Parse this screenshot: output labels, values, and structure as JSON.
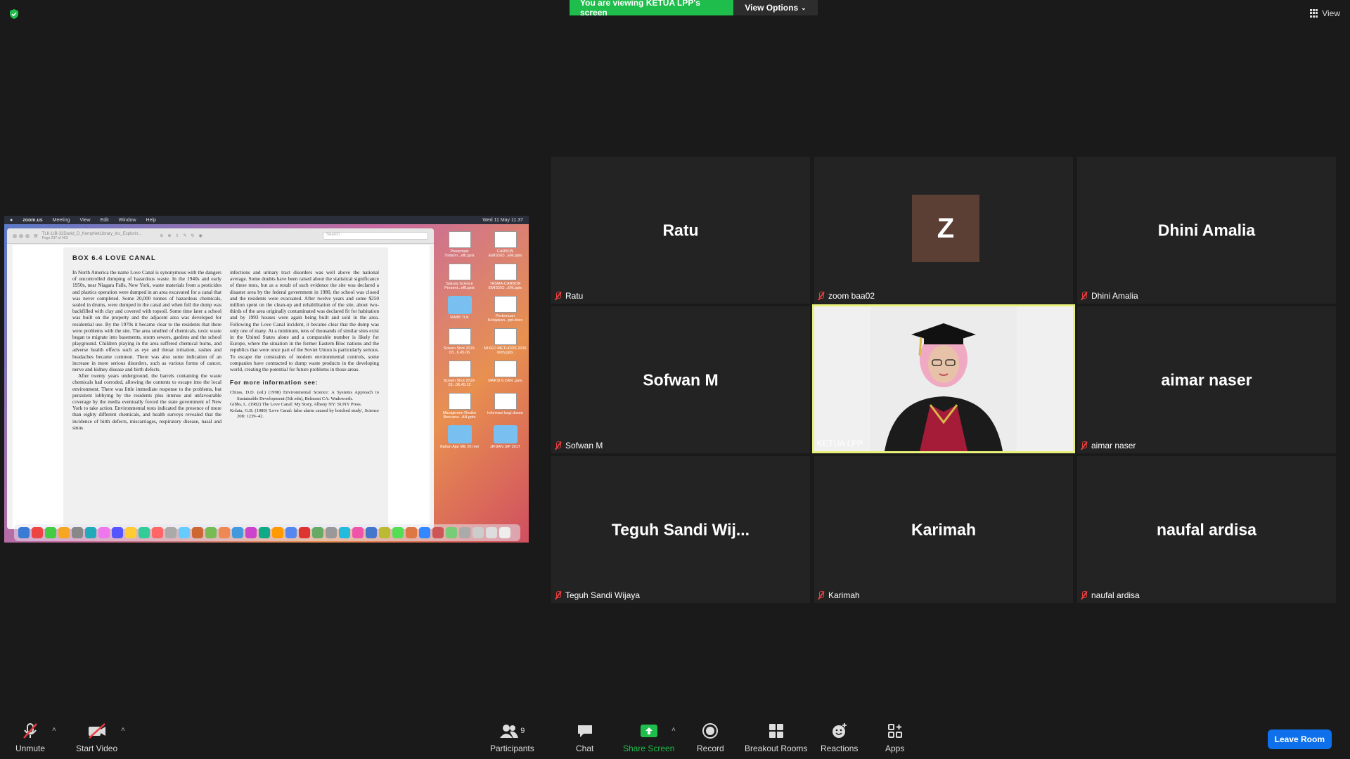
{
  "banner": {
    "viewing": "You are viewing KETUA LPP's screen",
    "view_options": "View Options"
  },
  "view_label": "View",
  "share": {
    "menubar": {
      "app": "zoom.us",
      "items": [
        "Meeting",
        "View",
        "Edit",
        "Window",
        "Help"
      ],
      "clock": "Wed 11 May  11.37"
    },
    "pdf_title": "TLK-LIB-32David_D_KempNetLibrary_Inc_Explorin...",
    "pdf_subtitle": "Page 237 of 463",
    "search_placeholder": "Search",
    "box_title": "BOX 6.4   LOVE CANAL",
    "col1_p1": "In North America the name Love Canal is synonymous with the dangers of uncontrolled dumping of hazardous waste. In the 1940s and early 1950s, near Niagara Falls, New York, waste materials from a pesticides and plastics operation were dumped in an area excavated for a canal that was never completed. Some 20,000 tonnes of hazardous chemicals, sealed in drums, were dumped in the canal and when full the dump was backfilled with clay and covered with topsoil. Some time later a school was built on the property and the adjacent area was developed for residential use. By the 1970s it became clear to the residents that there were problems with the site. The area smelled of chemicals, toxic waste began to migrate into basements, storm sewers, gardens and the school playground. Children playing in the area suffered chemical burns, and adverse health effects such as eye and throat irritation, rashes and headaches became common. There was also some indication of an increase in more serious disorders, such as various forms of cancer, nerve and kidney disease and birth defects.",
    "col1_p2": "After twenty years underground, the barrels containing the waste chemicals had corroded, allowing the contents to escape into the local environment. There was little immediate response to the problems, but persistent lobbying by the residents plus intense and unfavourable coverage by the media eventually forced the state government of New York to take action. Environmental tests indicated the presence of more than eighty different chemicals, and health surveys revealed that the incidence of birth defects, miscarriages, respiratory disease, nasal and sinus",
    "col2_p1": "infections and urinary tract disorders was well above the national average. Some doubts have been raised about the statistical significance of these tests, but as a result of such evidence the site was declared a disaster area by the federal government in 1980, the school was closed and the residents were evacuated. After twelve years and some $250 million spent on the clean-up and rehabilitation of the site, about two-thirds of the area originally contaminated was declared fit for habitation and by 1993 houses were again being built and sold in the area. Following the Love Canal incident, it became clear that the dump was only one of many. At a minimum, tens of thousands of similar sites exist in the United States alone and a comparable number is likely for Europe, where the situation in the former Eastern Bloc nations and the republics that were once part of the Soviet Union is particularly serious. To escape the constraints of modern environmental controls, some companies have contracted to dump waste products in the developing world, creating the potential for future problems in those areas.",
    "more_info": "For more information see:",
    "refs": [
      "Chiras, D.D. (ed.) (1998) Environmental Science: A Systems Approach to Sustainable Development (5th edn), Belmont CA: Wadsworth.",
      "Gibbs, L. (1982) The Love Canal: My Story, Albany NY: SUNY Press.",
      "Kolata, G.B. (1980) 'Love Canal: false alarm caused by botched study', Science 208: 1239–42."
    ],
    "desktop_icons": [
      {
        "label": "Presentasi Tridarm...effi.pptx",
        "kind": "thumb"
      },
      {
        "label": "CARBON EMISSIO...EM.pptx",
        "kind": "thumb"
      },
      {
        "label": "Sakura Science Present...effi.pptx",
        "kind": "thumb"
      },
      {
        "label": "TASMA-CARBON EMISSIO...EM.pptx",
        "kind": "thumb"
      },
      {
        "label": "RABB TLK",
        "kind": "folder"
      },
      {
        "label": "Pertemuan Kebijakan...ppt.docx",
        "kind": "thumb"
      },
      {
        "label": "Screen Shot 2019-03...6.45.06",
        "kind": "thumb"
      },
      {
        "label": "MIXED METHODS 2015 birth.pptx",
        "kind": "thumb"
      },
      {
        "label": "Screen Shot 2019-03...06.45.12",
        "kind": "thumb"
      },
      {
        "label": "MAKSI 6.CAN .pptx",
        "kind": "thumb"
      },
      {
        "label": "Manajemen Resiko Bencana...AN.pptx",
        "kind": "thumb"
      },
      {
        "label": "Informasi bagi dosen",
        "kind": "thumb"
      },
      {
        "label": "Bahan Ajar ME 20 mei",
        "kind": "folder"
      },
      {
        "label": "JIFSAN SIP 2017",
        "kind": "folder"
      }
    ]
  },
  "participants": [
    {
      "display": "Ratu",
      "label": "Ratu"
    },
    {
      "display": "Z",
      "label": "zoom baa02"
    },
    {
      "display": "Dhini Amalia",
      "label": "Dhini Amalia"
    },
    {
      "display": "Sofwan M",
      "label": "Sofwan M"
    },
    {
      "display": "",
      "label": "KETUA LPP"
    },
    {
      "display": "aimar naser",
      "label": "aimar naser"
    },
    {
      "display": "Teguh Sandi Wij...",
      "label": "Teguh Sandi Wijaya"
    },
    {
      "display": "Karimah",
      "label": "Karimah"
    },
    {
      "display": "naufal ardisa",
      "label": "naufal ardisa"
    }
  ],
  "toolbar": {
    "unmute": "Unmute",
    "start_video": "Start Video",
    "participants": "Participants",
    "participants_count": "9",
    "chat": "Chat",
    "share_screen": "Share Screen",
    "record": "Record",
    "breakout": "Breakout Rooms",
    "reactions": "Reactions",
    "apps": "Apps",
    "leave": "Leave Room"
  },
  "colors": {
    "share_green": "#1fbd4c",
    "active_border": "#e7f07a",
    "leave_blue": "#0e71eb",
    "muted_red": "#e53e3e"
  }
}
